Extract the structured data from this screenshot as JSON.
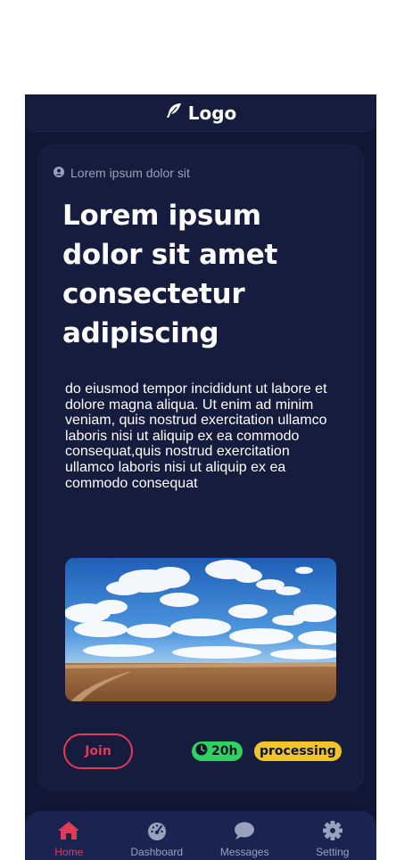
{
  "header": {
    "logo_text": "Logo",
    "logo_icon": "feather-icon"
  },
  "post": {
    "meta": "Lorem ipsum dolor sit",
    "meta_icon": "user-circle-icon",
    "title": "Lorem ipsum dolor sit amet consectetur adipiscing",
    "body": "do eiusmod tempor incididunt ut labore et dolore magna aliqua. Ut enim ad minim veniam, quis nostrud exercitation ullamco laboris nisi ut aliquip ex ea commodo consequat,quis nostrud exercitation ullamco laboris nisi ut aliquip ex ea commodo consequat",
    "image": "landscape-field-clouds",
    "join_label": "Join",
    "time_label": "20h",
    "time_icon": "clock-icon",
    "status_label": "processing"
  },
  "nav": {
    "items": [
      {
        "label": "Home",
        "icon": "home-icon",
        "active": true
      },
      {
        "label": "Dashboard",
        "icon": "gauge-icon",
        "active": false
      },
      {
        "label": "Messages",
        "icon": "chat-bubble-icon",
        "active": false
      },
      {
        "label": "Setting",
        "icon": "gear-icon",
        "active": false
      }
    ]
  },
  "colors": {
    "background": "#101633",
    "card": "#151c3d",
    "accent": "#e23a59",
    "time_badge": "#2fd25d",
    "status_badge": "#f2c42a"
  }
}
